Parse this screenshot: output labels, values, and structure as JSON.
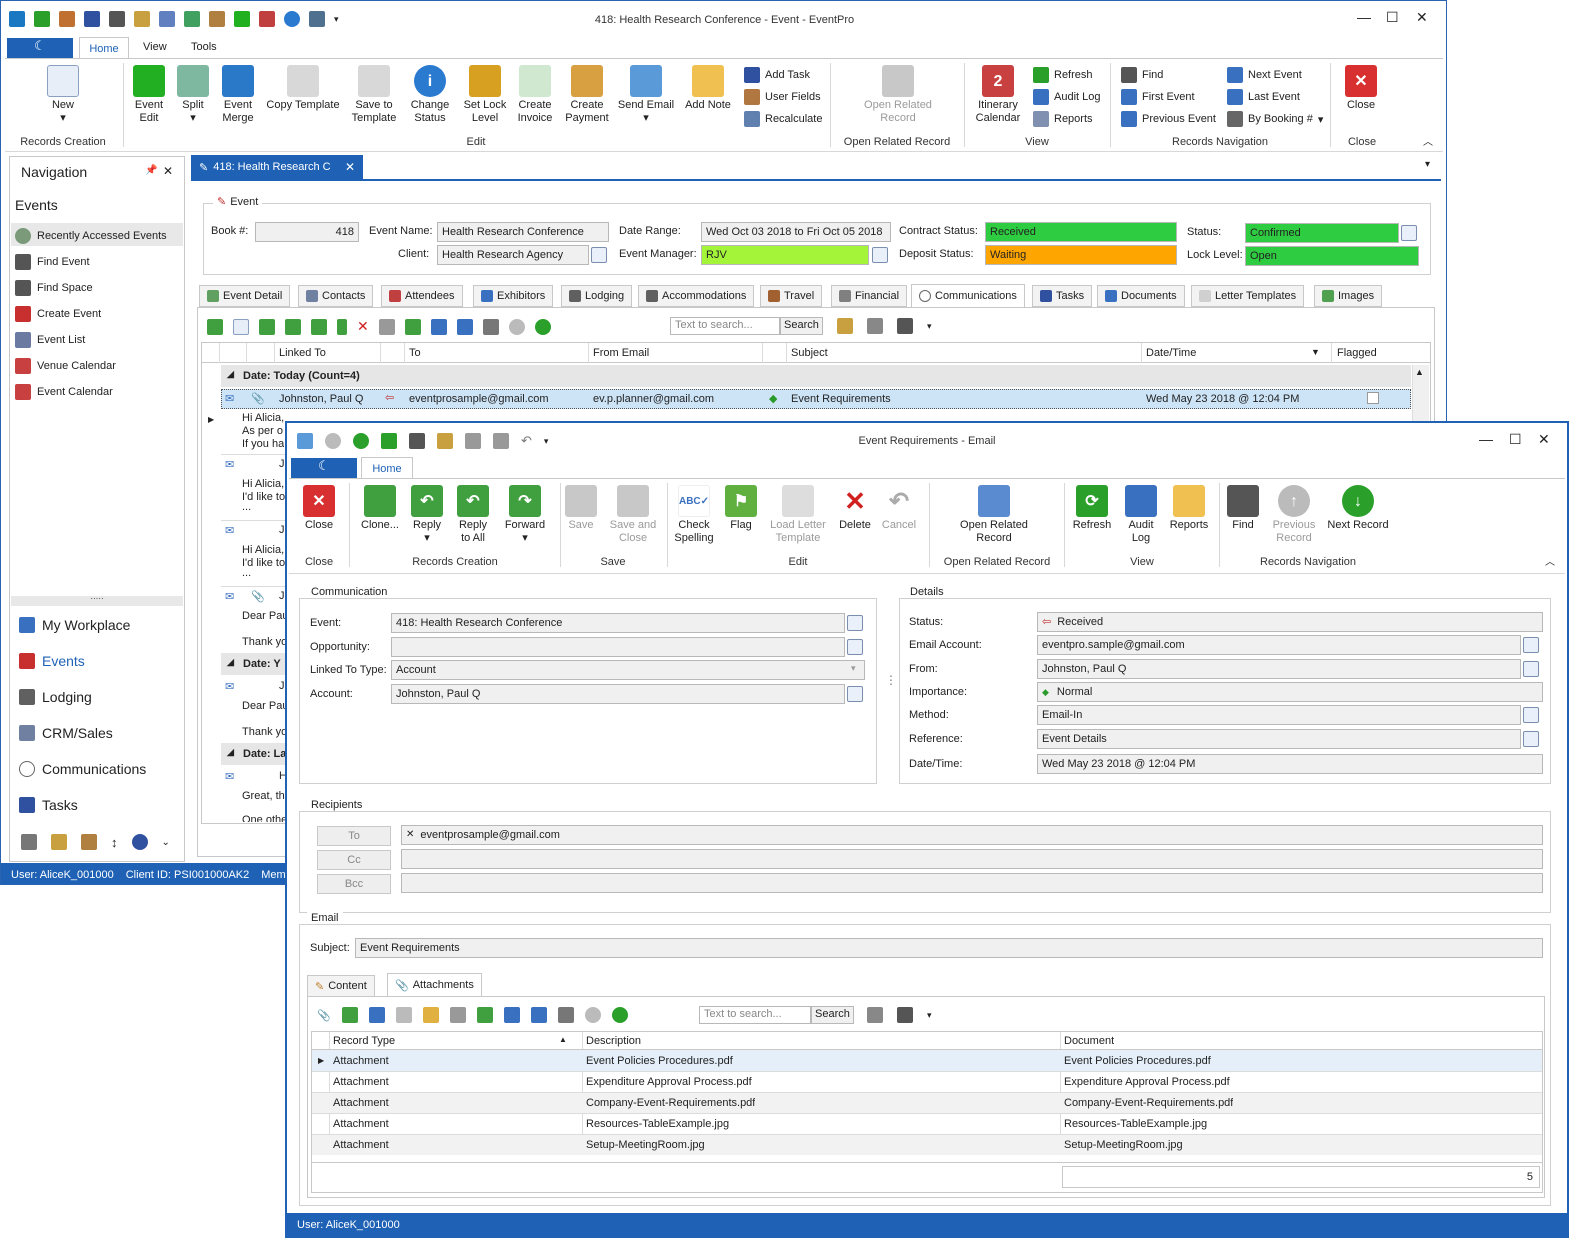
{
  "main": {
    "title": "418: Health Research Conference - Event - EventPro",
    "ribbon_tabs": [
      "Home",
      "View",
      "Tools"
    ],
    "ribbon": {
      "new": "New",
      "event_edit": "Event\nEdit",
      "split": "Split",
      "event_merge": "Event\nMerge",
      "copy_template": "Copy Template",
      "save_to_template": "Save to\nTemplate",
      "change_status": "Change\nStatus",
      "set_lock_level": "Set Lock\nLevel",
      "create_invoice": "Create\nInvoice",
      "create_payment": "Create\nPayment",
      "send_email": "Send Email",
      "add_note": "Add Note",
      "add_task": "Add Task",
      "user_fields": "User Fields",
      "recalculate": "Recalculate",
      "open_related": "Open Related\nRecord",
      "itinerary": "Itinerary\nCalendar",
      "refresh": "Refresh",
      "audit_log": "Audit Log",
      "reports": "Reports",
      "find": "Find",
      "first_event": "First Event",
      "previous_event": "Previous Event",
      "next_event": "Next Event",
      "last_event": "Last Event",
      "by_booking": "By Booking #",
      "close": "Close",
      "groups": [
        "Records Creation",
        "Edit",
        "Open Related Record",
        "View",
        "Records Navigation",
        "Close"
      ]
    },
    "nav": {
      "title": "Navigation",
      "section": "Events",
      "items": [
        "Recently Accessed Events",
        "Find Event",
        "Find Space",
        "Create Event",
        "Event List",
        "Venue Calendar",
        "Event Calendar"
      ],
      "modules": [
        "My Workplace",
        "Events",
        "Lodging",
        "CRM/Sales",
        "Communications",
        "Tasks"
      ]
    },
    "doc_tab": "418: Health Research C",
    "event": {
      "group": "Event",
      "book_label": "Book #:",
      "book": "418",
      "name_label": "Event Name:",
      "name": "Health Research Conference",
      "client_label": "Client:",
      "client": "Health Research Agency",
      "range_label": "Date Range:",
      "range": "Wed Oct 03 2018 to Fri Oct 05 2018",
      "manager_label": "Event Manager:",
      "manager": "RJV",
      "contract_label": "Contract Status:",
      "contract": "Received",
      "deposit_label": "Deposit Status:",
      "deposit": "Waiting",
      "status_label": "Status:",
      "status": "Confirmed",
      "lock_label": "Lock Level:",
      "lock": "Open"
    },
    "tabs": [
      "Event Detail",
      "Contacts",
      "Attendees",
      "Exhibitors",
      "Lodging",
      "Accommodations",
      "Travel",
      "Financial",
      "Communications",
      "Tasks",
      "Documents",
      "Letter Templates",
      "Images"
    ],
    "search_placeholder": "Text to search...",
    "search_btn": "Search",
    "grid": {
      "headers": [
        "Linked To",
        "To",
        "From Email",
        "Subject",
        "Date/Time",
        "Flagged"
      ],
      "group1": "Date: Today (Count=4)",
      "row": {
        "linked": "Johnston, Paul Q",
        "to": "eventprosample@gmail.com",
        "from": "ev.p.planner@gmail.com",
        "subject": "Event Requirements",
        "date": "Wed May 23 2018 @ 12:04 PM"
      },
      "previews": [
        "Hi Alicia,",
        "As per o",
        "If you ha",
        "Hi Alicia,",
        "I'd like to",
        "...",
        "Hi Alicia,",
        "I'd like to",
        "...",
        "Dear Pau",
        "Thank yo",
        "Dear Pau",
        "Thank yo",
        "Great, th",
        "One othe"
      ],
      "group2": "Date: Y",
      "group3": "Date: La"
    },
    "status": {
      "user": "User: AliceK_001000",
      "client": "Client ID: PSI001000AK2",
      "mem": "Memo"
    }
  },
  "email": {
    "title": "Event Requirements - Email",
    "tab": "Home",
    "ribbon": {
      "close": "Close",
      "clone": "Clone...",
      "reply": "Reply",
      "reply_all": "Reply\nto All",
      "forward": "Forward",
      "save": "Save",
      "save_close": "Save and\nClose",
      "check_spelling": "Check\nSpelling",
      "flag": "Flag",
      "load_letter": "Load Letter\nTemplate",
      "delete": "Delete",
      "cancel": "Cancel",
      "open_related": "Open Related\nRecord",
      "refresh": "Refresh",
      "audit_log": "Audit\nLog",
      "reports": "Reports",
      "find": "Find",
      "previous": "Previous\nRecord",
      "next": "Next Record",
      "groups": [
        "Close",
        "Records Creation",
        "Save",
        "Edit",
        "Open Related Record",
        "View",
        "Records Navigation"
      ]
    },
    "comm": {
      "group": "Communication",
      "event_label": "Event:",
      "event": "418: Health Research Conference",
      "opp_label": "Opportunity:",
      "opp": "",
      "linked_label": "Linked To Type:",
      "linked": "Account",
      "account_label": "Account:",
      "account": "Johnston, Paul Q"
    },
    "details": {
      "group": "Details",
      "status_label": "Status:",
      "status": "Received",
      "acct_label": "Email Account:",
      "acct": "eventpro.sample@gmail.com",
      "from_label": "From:",
      "from": "Johnston, Paul Q",
      "imp_label": "Importance:",
      "imp": "Normal",
      "method_label": "Method:",
      "method": "Email-In",
      "ref_label": "Reference:",
      "ref": "Event Details",
      "dt_label": "Date/Time:",
      "dt": "Wed May 23 2018 @ 12:04 PM"
    },
    "recipients": {
      "group": "Recipients",
      "to": "To",
      "cc": "Cc",
      "bcc": "Bcc",
      "to_value": "eventprosample@gmail.com"
    },
    "mail": {
      "group": "Email",
      "subject_label": "Subject:",
      "subject": "Event Requirements"
    },
    "subtabs": [
      "Content",
      "Attachments"
    ],
    "search_placeholder": "Text to search...",
    "search_btn": "Search",
    "att": {
      "headers": [
        "Record Type",
        "Description",
        "Document"
      ],
      "rows": [
        [
          "Attachment",
          "Event Policies Procedures.pdf",
          "Event Policies Procedures.pdf"
        ],
        [
          "Attachment",
          "Expenditure Approval Process.pdf",
          "Expenditure Approval Process.pdf"
        ],
        [
          "Attachment",
          "Company-Event-Requirements.pdf",
          "Company-Event-Requirements.pdf"
        ],
        [
          "Attachment",
          "Resources-TableExample.jpg",
          "Resources-TableExample.jpg"
        ],
        [
          "Attachment",
          "Setup-MeetingRoom.jpg",
          "Setup-MeetingRoom.jpg"
        ]
      ],
      "count": "5"
    },
    "status": "User: AliceK_001000"
  },
  "colors": {
    "accent": "#1f62b5",
    "green": "#2ecc40",
    "orange": "#ffa500",
    "lime": "#a4f53a"
  }
}
